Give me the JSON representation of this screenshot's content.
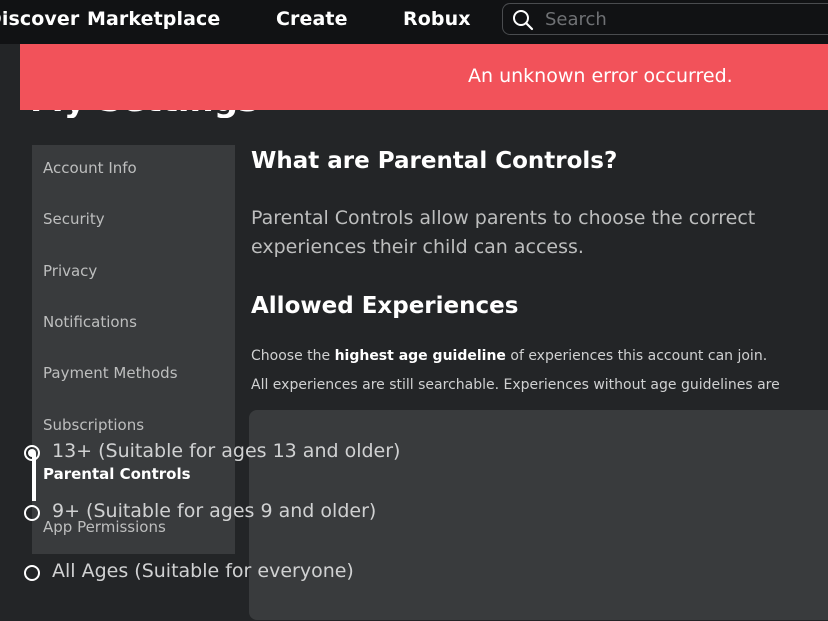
{
  "nav": {
    "discover_label": "Discover",
    "marketplace_label": "Marketplace",
    "create_label": "Create",
    "robux_label": "Robux",
    "search_placeholder": "Search"
  },
  "error_banner": {
    "message": "An unknown error occurred."
  },
  "page_title": "My Settings",
  "sidebar": {
    "items": [
      {
        "label": "Account Info"
      },
      {
        "label": "Security"
      },
      {
        "label": "Privacy"
      },
      {
        "label": "Notifications"
      },
      {
        "label": "Payment Methods"
      },
      {
        "label": "Subscriptions"
      },
      {
        "label": "Parental Controls",
        "active": true
      },
      {
        "label": "App Permissions"
      }
    ]
  },
  "main": {
    "heading": "What are Parental Controls?",
    "description": "Parental Controls allow parents to choose the correct experiences their child can access.",
    "allowed_heading": "Allowed Experiences",
    "hint_prefix": "Choose the ",
    "hint_bold": "highest age guideline",
    "hint_suffix": " of experiences this account can join.",
    "hint2": "All experiences are still searchable. Experiences without age guidelines are",
    "options": [
      {
        "label": "13+ (Suitable for ages 13 and older)",
        "selected": true
      },
      {
        "label": "9+ (Suitable for ages 9 and older)",
        "selected": false
      },
      {
        "label": "All Ages (Suitable for everyone)",
        "selected": false
      }
    ]
  },
  "colors": {
    "background": "#232527",
    "nav_background": "#111214",
    "error_banner": "#f2525a",
    "panel": "#393b3d"
  },
  "icons": {
    "search": "search-icon"
  }
}
